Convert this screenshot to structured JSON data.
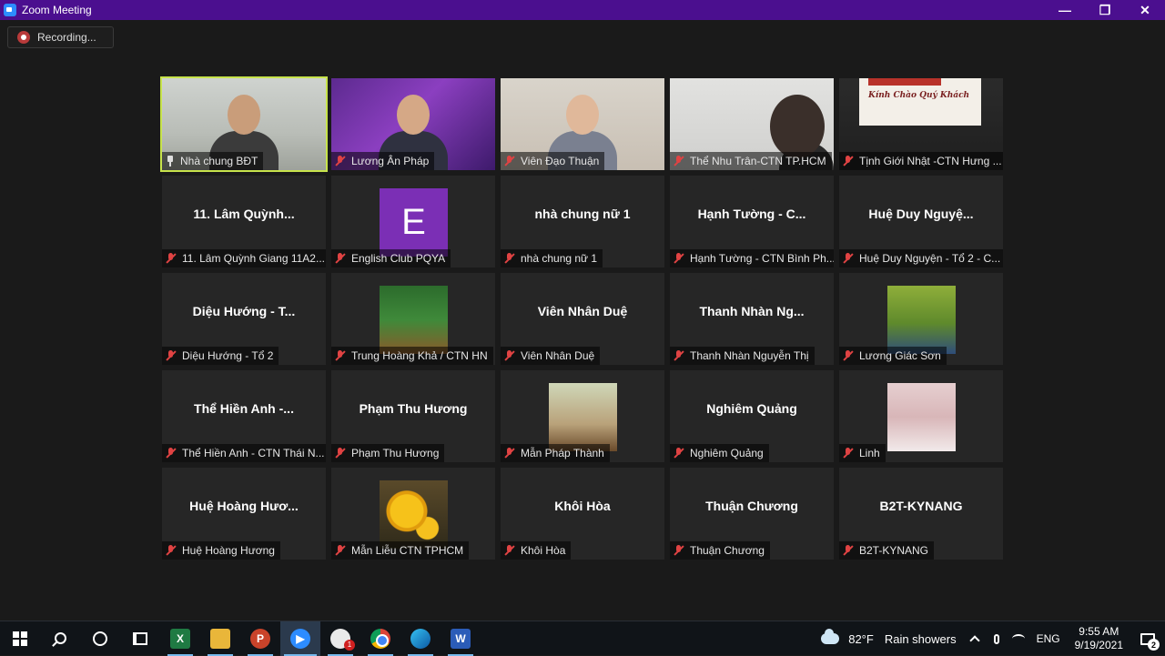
{
  "window": {
    "title": "Zoom Meeting",
    "minimize": "—",
    "restore": "❐",
    "close": "✕"
  },
  "recording": {
    "label": "Recording..."
  },
  "tiles": [
    {
      "caption": "Nhà chung BĐT",
      "kind": "video",
      "scene": "room",
      "pinned": true
    },
    {
      "caption": "Lương Ân Pháp",
      "kind": "video",
      "scene": "stage"
    },
    {
      "caption": "Viên Đạo Thuận",
      "kind": "video",
      "scene": "girl"
    },
    {
      "caption": "Thể Nhu Trân-CTN TP.HCM",
      "kind": "video",
      "scene": "glasses"
    },
    {
      "caption": "Tịnh Giới Nhật -CTN Hưng ...",
      "kind": "video",
      "scene": "sign",
      "sign_text": "Kính Chào Quý Khách"
    },
    {
      "caption": "11. Lâm Quỳnh Giang 11A2...",
      "kind": "name",
      "big": "11. Lâm Quỳnh..."
    },
    {
      "caption": "English Club PQYA",
      "kind": "avatar",
      "letter": "E",
      "avatar": "letter"
    },
    {
      "caption": "nhà chung nữ 1",
      "kind": "name",
      "big": "nhà chung nữ 1"
    },
    {
      "caption": "Hạnh Tường - CTN Bình Ph...",
      "kind": "name",
      "big": "Hạnh Tường - C..."
    },
    {
      "caption": "Huệ Duy Nguyện - Tổ 2 - C...",
      "kind": "name",
      "big": "Huệ Duy Nguyệ..."
    },
    {
      "caption": "Diệu Hướng - Tổ 2",
      "kind": "name",
      "big": "Diệu Hướng - T..."
    },
    {
      "caption": "Trung Hoàng Khả / CTN HN",
      "kind": "avatar",
      "avatar": "boy"
    },
    {
      "caption": "Viên Nhân Duệ",
      "kind": "name",
      "big": "Viên Nhân Duệ"
    },
    {
      "caption": "Thanh Nhàn Nguyễn Thị",
      "kind": "name",
      "big": "Thanh Nhàn Ng..."
    },
    {
      "caption": "Lương Giác Sơn",
      "kind": "avatar",
      "avatar": "man"
    },
    {
      "caption": "Thể Hiền Anh - CTN Thái N...",
      "kind": "name",
      "big": "Thể Hiền Anh -..."
    },
    {
      "caption": "Phạm Thu Hương",
      "kind": "name",
      "big": "Phạm Thu Hương"
    },
    {
      "caption": "Mẫn Pháp Thành",
      "kind": "avatar",
      "avatar": "woman"
    },
    {
      "caption": "Nghiêm Quảng",
      "kind": "name",
      "big": "Nghiêm Quảng"
    },
    {
      "caption": "Linh",
      "kind": "avatar",
      "avatar": "girl"
    },
    {
      "caption": "Huệ Hoàng Hương",
      "kind": "name",
      "big": "Huệ Hoàng Hươ..."
    },
    {
      "caption": "Mẫn Liễu CTN TPHCM",
      "kind": "avatar",
      "avatar": "flower"
    },
    {
      "caption": "Khôi Hòa",
      "kind": "name",
      "big": "Khôi Hòa"
    },
    {
      "caption": "Thuận Chương",
      "kind": "name",
      "big": "Thuận Chương"
    },
    {
      "caption": "B2T-KYNANG",
      "kind": "name",
      "big": "B2T-KYNANG"
    }
  ],
  "taskbar": {
    "apps": [
      {
        "name": "excel",
        "glyph": "X"
      },
      {
        "name": "file-explorer",
        "glyph": ""
      },
      {
        "name": "powerpoint",
        "glyph": "P"
      },
      {
        "name": "zoom",
        "glyph": "▶",
        "active": true
      },
      {
        "name": "messenger",
        "glyph": "",
        "badge": "1"
      },
      {
        "name": "chrome",
        "glyph": ""
      },
      {
        "name": "edge",
        "glyph": ""
      },
      {
        "name": "word",
        "glyph": "W"
      }
    ],
    "weather": {
      "temp": "82°F",
      "condition": "Rain showers"
    },
    "language": "ENG",
    "time": "9:55 AM",
    "date": "9/19/2021",
    "notification_count": "2"
  }
}
